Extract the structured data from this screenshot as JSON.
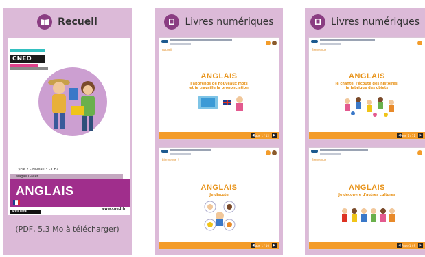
{
  "recueil": {
    "title": "Recueil",
    "caption": "(PDF, 5.3 Mo à télécharger)",
    "cover": {
      "brand": "CNED",
      "level": "Cycle 2 – Niveau 3 – CE2",
      "author": "Magali Gallet",
      "title": "ANGLAIS",
      "tag": "RECUEIL",
      "site": "www.cned.fr"
    }
  },
  "livres1": {
    "title": "Livres numériques",
    "screens": [
      {
        "sub": "Accueil",
        "title": "ANGLAIS",
        "subtitle": "J'apprends de nouveaux mots\net je travaille la prononciation",
        "page": "Page 1 / 12"
      },
      {
        "sub": "Bienvenue !",
        "title": "ANGLAIS",
        "subtitle": "Je discute",
        "page": "Page 1 / 10"
      }
    ]
  },
  "livres2": {
    "title": "Livres numériques",
    "screens": [
      {
        "sub": "Bienvenue !",
        "title": "ANGLAIS",
        "subtitle": "Je chante, j'écoute des histoires,\nje fabrique des objets",
        "page": "Page 1 / 11"
      },
      {
        "sub": "Bienvenue !",
        "title": "ANGLAIS",
        "subtitle": "Je découvre d'autres cultures",
        "page": "Page 1 / 9"
      }
    ]
  },
  "icons": {
    "recueil": "book-icon",
    "livres": "tablet-icon"
  },
  "colors": {
    "panel": "#dcbad8",
    "accent": "#8a3d82",
    "orange": "#f39c2a",
    "cover_band": "#a02e8c"
  }
}
